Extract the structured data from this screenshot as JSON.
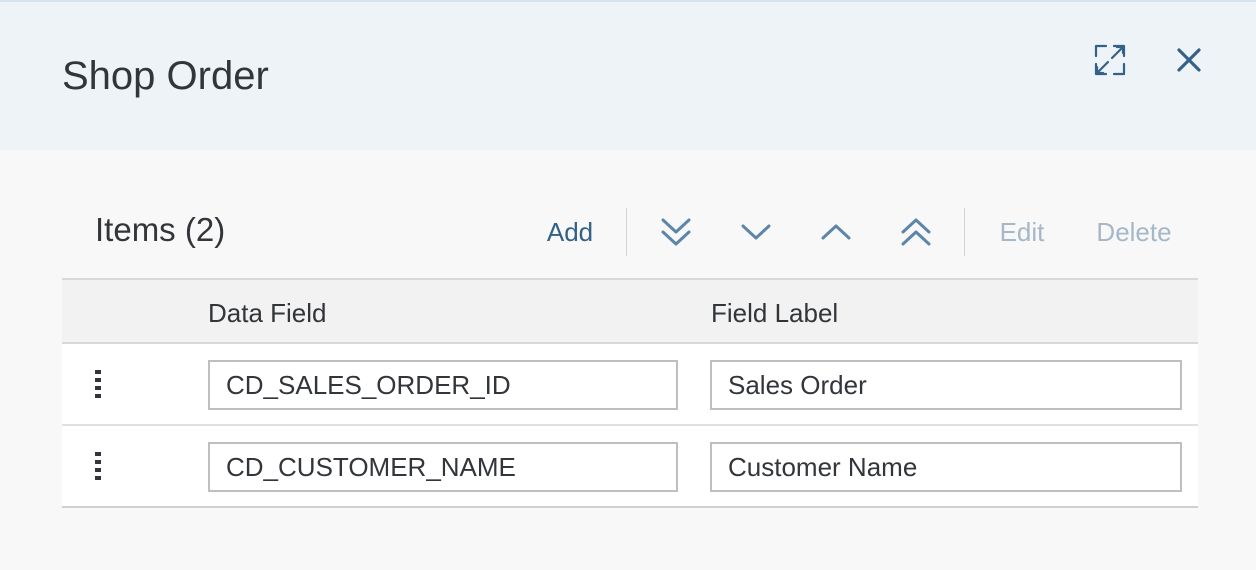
{
  "dialog": {
    "title": "Shop Order"
  },
  "header_actions": [
    {
      "name": "expand",
      "icon": "expand-icon"
    },
    {
      "name": "close",
      "icon": "close-icon"
    }
  ],
  "toolbar": {
    "title": "Items (2)",
    "add_label": "Add",
    "move_icons": [
      "move-to-bottom-icon",
      "move-down-icon",
      "move-up-icon",
      "move-to-top-icon"
    ],
    "edit_label": "Edit",
    "delete_label": "Delete"
  },
  "table": {
    "columns": [
      "Data Field",
      "Field Label"
    ],
    "rows": [
      {
        "data_field": "CD_SALES_ORDER_ID",
        "field_label": "Sales Order"
      },
      {
        "data_field": "CD_CUSTOMER_NAME",
        "field_label": "Customer Name"
      }
    ]
  },
  "colors": {
    "header_bg": "#eef3f8",
    "accent": "#346187",
    "disabled": "#a5b8c9",
    "text": "#32363a"
  }
}
